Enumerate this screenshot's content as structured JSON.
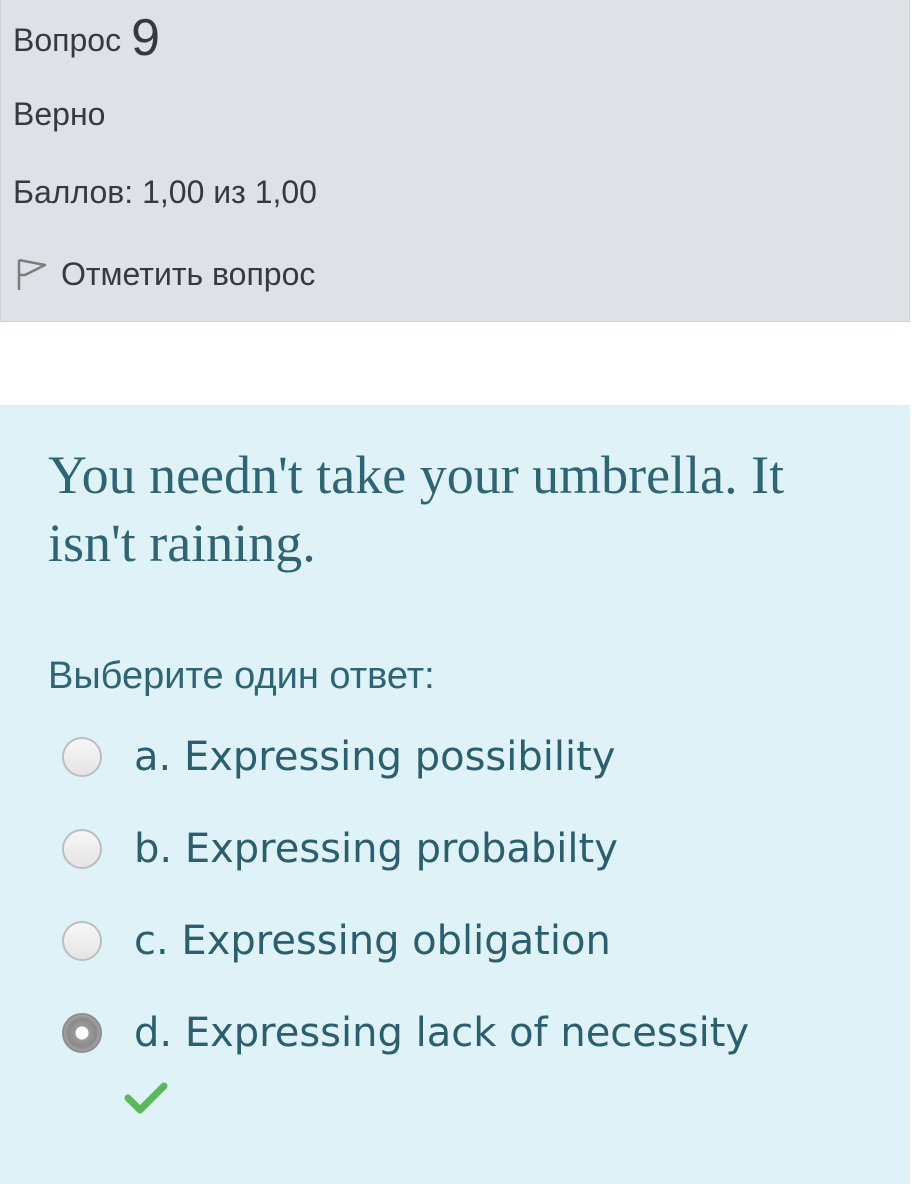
{
  "question_info": {
    "label": "Вопрос",
    "number": "9",
    "state": "Верно",
    "grade": "Баллов: 1,00 из 1,00",
    "flag_label": "Отметить вопрос"
  },
  "question": {
    "text": "You needn't take your umbrella. It isn't raining.",
    "prompt": "Выберите один ответ:",
    "options": [
      {
        "label": "a. Expressing possibility",
        "selected": false
      },
      {
        "label": "b. Expressing probabilty",
        "selected": false
      },
      {
        "label": "c. Expressing obligation",
        "selected": false
      },
      {
        "label": "d. Expressing lack of necessity",
        "selected": true,
        "correct": true
      }
    ]
  },
  "colors": {
    "info_background": "#dee2e6",
    "content_background": "#def2f8",
    "text_teal": "#2f6473",
    "correct_check": "#5cb85c"
  },
  "icons": {
    "flag": "flag-icon",
    "correct": "check-icon"
  }
}
